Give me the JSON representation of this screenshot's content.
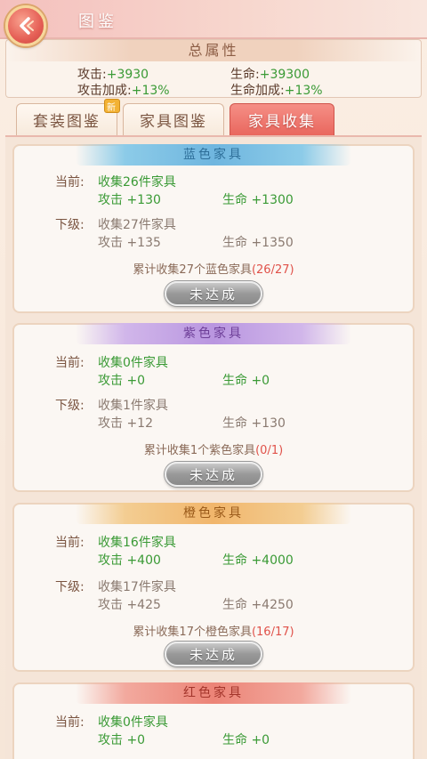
{
  "header": {
    "title": "图鉴"
  },
  "total_attributes": {
    "title": "总属性",
    "attack_label": "攻击:",
    "attack_value": "+3930",
    "hp_label": "生命:",
    "hp_value": "+39300",
    "attack_bonus_label": "攻击加成:",
    "attack_bonus_value": "+13%",
    "hp_bonus_label": "生命加成:",
    "hp_bonus_value": "+13%"
  },
  "tabs": [
    {
      "label": "套装图鉴",
      "badge": "新",
      "active": false
    },
    {
      "label": "家具图鉴",
      "active": false
    },
    {
      "label": "家具收集",
      "active": true
    }
  ],
  "cards": [
    {
      "title": "蓝色家具",
      "current_label": "当前:",
      "current_collect": "收集26件家具",
      "current_attack": "攻击 +130",
      "current_hp": "生命 +1300",
      "next_label": "下级:",
      "next_collect": "收集27件家具",
      "next_attack": "攻击 +135",
      "next_hp": "生命 +1350",
      "summary": "累计收集27个蓝色家具",
      "progress": "(26/27)",
      "button": "未达成"
    },
    {
      "title": "紫色家具",
      "current_label": "当前:",
      "current_collect": "收集0件家具",
      "current_attack": "攻击 +0",
      "current_hp": "生命 +0",
      "next_label": "下级:",
      "next_collect": "收集1件家具",
      "next_attack": "攻击 +12",
      "next_hp": "生命 +130",
      "summary": "累计收集1个紫色家具",
      "progress": "(0/1)",
      "button": "未达成"
    },
    {
      "title": "橙色家具",
      "current_label": "当前:",
      "current_collect": "收集16件家具",
      "current_attack": "攻击 +400",
      "current_hp": "生命 +4000",
      "next_label": "下级:",
      "next_collect": "收集17件家具",
      "next_attack": "攻击 +425",
      "next_hp": "生命 +4250",
      "summary": "累计收集17个橙色家具",
      "progress": "(16/17)",
      "button": "未达成"
    },
    {
      "title": "红色家具",
      "current_label": "当前:",
      "current_collect": "收集0件家具",
      "current_attack": "攻击 +0",
      "current_hp": "生命 +0"
    }
  ],
  "colors": {
    "accent": "#e9675e",
    "green": "#3a9a35",
    "progress_red": "#e0524a"
  }
}
